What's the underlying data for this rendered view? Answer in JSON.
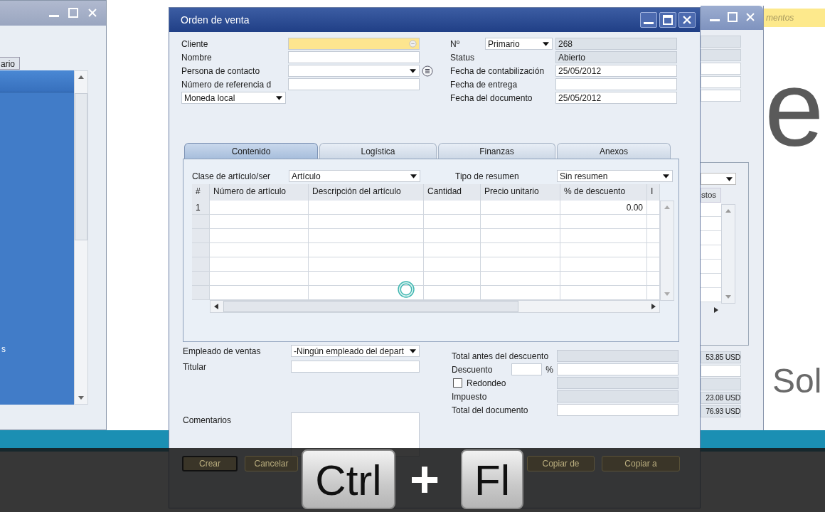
{
  "left_window": {
    "tab_label": "ario",
    "list_text": "s"
  },
  "right_window": {
    "column_header": "stos",
    "totals": [
      "53.85 USD",
      "23.08 USD",
      "76.93 USD"
    ]
  },
  "backdrop": {
    "banner_text": "mentos",
    "logo_letter": "e",
    "logo_text": "Sol"
  },
  "window": {
    "title": "Orden de venta"
  },
  "header_left": [
    {
      "kind": "lookup",
      "label": "Cliente",
      "highlighted": true
    },
    {
      "kind": "text",
      "label": "Nombre",
      "highlighted": false
    },
    {
      "kind": "combo",
      "label": "Persona de contacto",
      "highlighted": false
    },
    {
      "kind": "text",
      "label": "Número de referencia d",
      "highlighted": false
    }
  ],
  "currency": "Moneda local",
  "header_right": [
    {
      "kind": "series",
      "label": "Nº",
      "series": "Primario",
      "value": "268",
      "readonly": true
    },
    {
      "kind": "text",
      "label": "Status",
      "value": "Abierto",
      "readonly": true
    },
    {
      "kind": "text",
      "label": "Fecha de contabilización",
      "value": "25/05/2012",
      "readonly": false
    },
    {
      "kind": "text",
      "label": "Fecha de entrega",
      "readonly": false
    },
    {
      "kind": "text",
      "label": "Fecha del documento",
      "value": "25/05/2012",
      "readonly": false
    }
  ],
  "tabs": [
    {
      "label": "Contenido",
      "selected": true
    },
    {
      "label": "Logística",
      "selected": false
    },
    {
      "label": "Finanzas",
      "selected": false
    },
    {
      "label": "Anexos",
      "selected": false
    }
  ],
  "item_type": {
    "label": "Clase de artículo/ser",
    "value": "Artículo"
  },
  "summary_type": {
    "label": "Tipo de resumen",
    "value": "Sin resumen"
  },
  "table": {
    "columns": [
      "#",
      "Número de artículo",
      "Descripción del artículo",
      "Cantidad",
      "Precio unitario",
      "% de descuento",
      "I"
    ],
    "rows": [
      {
        "number": "1",
        "discount": "0.00"
      }
    ]
  },
  "sales_employee": {
    "label": "Empleado de ventas",
    "value": "-Ningún empleado del depart"
  },
  "owner": {
    "label": "Titular"
  },
  "comments": {
    "label": "Comentarios"
  },
  "totals": [
    {
      "kind": "field",
      "label": "Total antes del descuento",
      "readonly": true
    },
    {
      "kind": "percent",
      "label": "Descuento",
      "unit": "%",
      "readonly": false
    },
    {
      "kind": "checkbox",
      "label": "Redondeo",
      "checked": false,
      "readonly": true
    },
    {
      "kind": "field",
      "label": "Impuesto",
      "readonly": true
    },
    {
      "kind": "field",
      "label": "Total del documento",
      "readonly": false
    }
  ],
  "buttons": [
    "Crear",
    "Cancelar",
    "Copiar de",
    "Copiar a"
  ],
  "shortcut": {
    "keys": [
      "Ctrl",
      "Fl"
    ],
    "joiner": "+"
  }
}
